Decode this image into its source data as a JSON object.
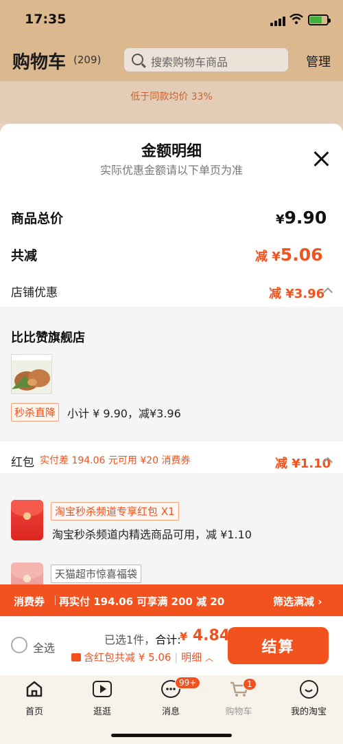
{
  "status": {
    "time": "17:35"
  },
  "header": {
    "title": "购物车",
    "count": "(209)",
    "search_placeholder": "搜索购物车商品",
    "manage": "管理"
  },
  "dim_note": "低于同款均价 33%",
  "sheet": {
    "title": "金额明细",
    "subtitle": "实际优惠金额请以下单页为准",
    "total_label": "商品总价",
    "total_currency": "¥",
    "total_value": "9.90",
    "reduce_label": "共减",
    "reduce_prefix": "减 ¥",
    "reduce_value": "5.06",
    "shop_discount_label": "店铺优惠",
    "shop_discount_value": "减 ¥3.96",
    "shop_name": "比比赞旗舰店",
    "seckill_tag": "秒杀直降",
    "subtotal": "小计 ¥ 9.90，减¥3.96",
    "hongbao_label": "红包",
    "hongbao_note": "实付差 194.06 元可用 ¥20 消费券",
    "hongbao_value": "减 ¥1.10",
    "packs": [
      {
        "tag": "淘宝秒杀频道专享红包 X1",
        "desc": "淘宝秒杀频道内精选商品可用，减 ¥1.10"
      },
      {
        "tag": "天猫超市惊喜福袋"
      }
    ]
  },
  "coupon_bar": {
    "tag": "消费券",
    "text": "再实付 194.06 可享满 200 减 20",
    "filter": "筛选满减 ›"
  },
  "checkout": {
    "select_all": "全选",
    "selected": "已选1件，",
    "sum_label": "合计:",
    "sum_currency": "¥",
    "sum_value": "4.84",
    "pack_save": "含红包共减 ¥ 5.06",
    "detail": "明细",
    "button": "结算"
  },
  "tabs": [
    {
      "label": "首页",
      "icon": "home-icon"
    },
    {
      "label": "逛逛",
      "icon": "play-icon"
    },
    {
      "label": "消息",
      "icon": "message-icon",
      "badge": "99+"
    },
    {
      "label": "购物车",
      "icon": "cart-icon",
      "badge": "1"
    },
    {
      "label": "我的淘宝",
      "icon": "smile-icon"
    }
  ],
  "colors": {
    "accent": "#f1521e",
    "backdrop": "#dcb88f"
  }
}
